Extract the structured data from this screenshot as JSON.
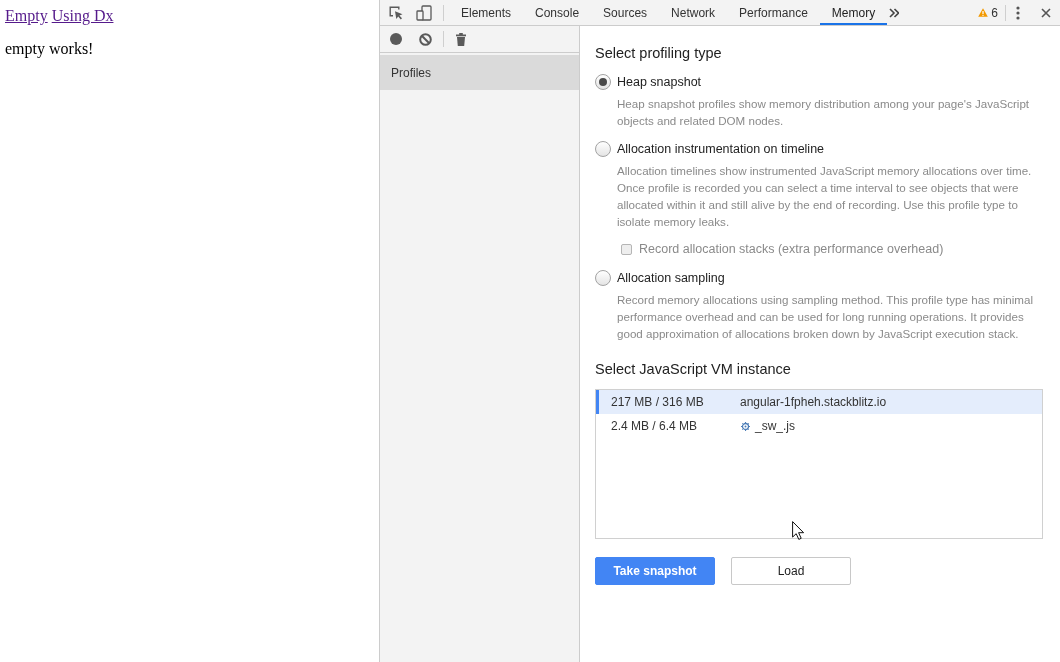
{
  "page": {
    "links": [
      "Empty",
      "Using Dx"
    ],
    "text": "empty works!"
  },
  "devtools": {
    "tabs": [
      {
        "label": "Elements",
        "selected": false
      },
      {
        "label": "Console",
        "selected": false
      },
      {
        "label": "Sources",
        "selected": false
      },
      {
        "label": "Network",
        "selected": false
      },
      {
        "label": "Performance",
        "selected": false
      },
      {
        "label": "Memory",
        "selected": true
      }
    ],
    "warning_count": "6",
    "sidebar": {
      "section_title": "Profiles"
    },
    "panel": {
      "profiling_heading": "Select profiling type",
      "profile_types": [
        {
          "label": "Heap snapshot",
          "selected": true,
          "description": "Heap snapshot profiles show memory distribution among your page's JavaScript objects and related DOM nodes."
        },
        {
          "label": "Allocation instrumentation on timeline",
          "selected": false,
          "description": "Allocation timelines show instrumented JavaScript memory allocations over time. Once profile is recorded you can select a time interval to see objects that were allocated within it and still alive by the end of recording. Use this profile type to isolate memory leaks.",
          "options": [
            {
              "label": "Record allocation stacks (extra performance overhead)",
              "checked": false,
              "disabled": true
            }
          ]
        },
        {
          "label": "Allocation sampling",
          "selected": false,
          "description": "Record memory allocations using sampling method. This profile type has minimal performance overhead and can be used for long running operations. It provides good approximation of allocations broken down by JavaScript execution stack."
        }
      ],
      "vm_heading": "Select JavaScript VM instance",
      "vm_instances": [
        {
          "memory": "217 MB / 316 MB",
          "name": "angular-1fpheh.stackblitz.io",
          "kind": "page",
          "selected": true
        },
        {
          "memory": "2.4 MB / 6.4 MB",
          "name": "_sw_.js",
          "kind": "worker",
          "selected": false
        }
      ],
      "buttons": [
        {
          "label": "Take snapshot",
          "kind": "primary"
        },
        {
          "label": "Load",
          "kind": "secondary"
        }
      ]
    }
  }
}
